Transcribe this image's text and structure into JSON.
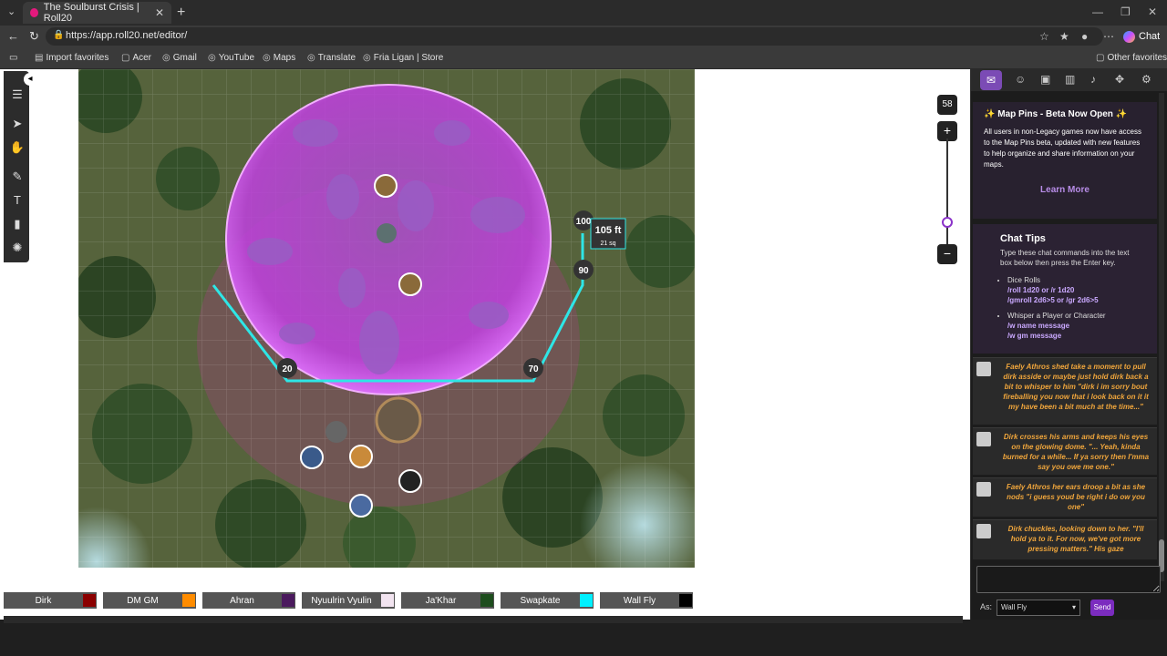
{
  "browser": {
    "tab_title": "The Soulburst Crisis | Roll20",
    "url": "https://app.roll20.net/editor/",
    "chat_label": "Chat",
    "bookmarks": [
      "Import favorites",
      "Acer",
      "Gmail",
      "YouTube",
      "Maps",
      "Translate",
      "Fria Ligan | Store"
    ],
    "other_favorites": "Other favorites"
  },
  "map": {
    "measure_labels": [
      "20",
      "70",
      "90",
      "100"
    ],
    "distance": "105 ft",
    "distance_squares": "21 sq"
  },
  "zoom": {
    "level": "58"
  },
  "players": [
    {
      "name": "Dirk",
      "color": "#8b0000"
    },
    {
      "name": "DM GM",
      "color": "#ff8c00"
    },
    {
      "name": "Ahran",
      "color": "#4b1a5e"
    },
    {
      "name": "Nyuulrin Vyulin",
      "color": "#f2e4f0"
    },
    {
      "name": "Ja'Khar",
      "color": "#1d4d1d"
    },
    {
      "name": "Swapkate",
      "color": "#00f0ff"
    },
    {
      "name": "Wall Fly",
      "color": "#000000"
    }
  ],
  "panel": {
    "announcement": {
      "title": "Map Pins - Beta Now Open",
      "body": "All users in non-Legacy games now have access to the Map Pins beta, updated with new features to help organize and share information on your maps.",
      "learn_more": "Learn More"
    },
    "tips": {
      "title": "Chat Tips",
      "description": "Type these chat commands into the text box below then press the Enter key.",
      "dice_heading": "Dice Rolls",
      "dice_line1": "/roll 1d20 or /r 1d20",
      "dice_line2": "/gmroll 2d6>5 or /gr 2d6>5",
      "whisper_heading": "Whisper a Player or Character",
      "whisper_line1": "/w name message",
      "whisper_line2": "/w gm message"
    },
    "messages": [
      "Faely Athros shed take a moment to pull dirk asside or maybe just hold dirk back a bit to whisper to him \"dirk i im sorry bout fireballing you now that i look back on it it my have been a bit much at the time...\"",
      "Dirk crosses his arms and keeps his eyes on the glowing dome. \"... Yeah, kinda burned for a while... If ya sorry then I'mma say you owe me one.\"",
      "Faely Athros her ears droop a bit as she nods \"i guess youd be right i do ow you one\"",
      "Dirk chuckles, looking down to her. \"I'll hold ya to it. For now, we've got more pressing matters.\" His gaze"
    ],
    "as_label": "As:",
    "as_value": "Wall Fly",
    "send_label": "Send"
  }
}
